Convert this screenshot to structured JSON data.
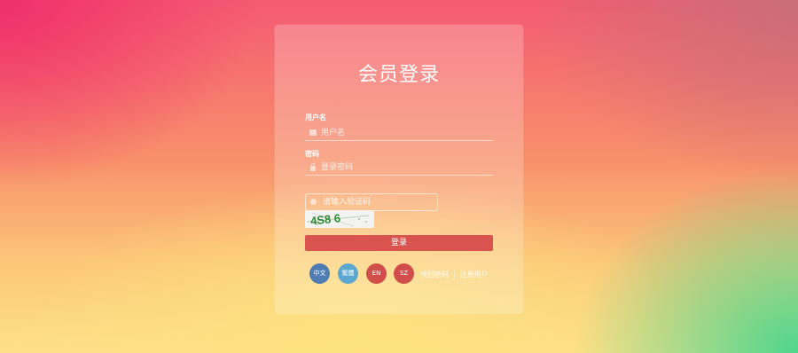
{
  "login": {
    "title": "会员登录",
    "username_label": "用户名",
    "username_placeholder": "用户名",
    "password_label": "密码",
    "password_placeholder": "登录密码",
    "captcha_placeholder": "请输入验证码",
    "captcha_text": "4S8 6",
    "submit_label": "登录"
  },
  "languages": [
    {
      "label": "中文",
      "color": "#4f7cb3"
    },
    {
      "label": "繁體",
      "color": "#5aa8cf"
    },
    {
      "label": "EN",
      "color": "#d24e4a"
    },
    {
      "label": "SZ",
      "color": "#d24e4a"
    }
  ],
  "links": {
    "forgot_password": "找回密码",
    "separator": "|",
    "register": "注册用户"
  },
  "icons": {
    "username": "user-icon",
    "password": "lock-icon",
    "captcha": "shield-icon"
  },
  "colors": {
    "primary_button": "#d9534f"
  }
}
